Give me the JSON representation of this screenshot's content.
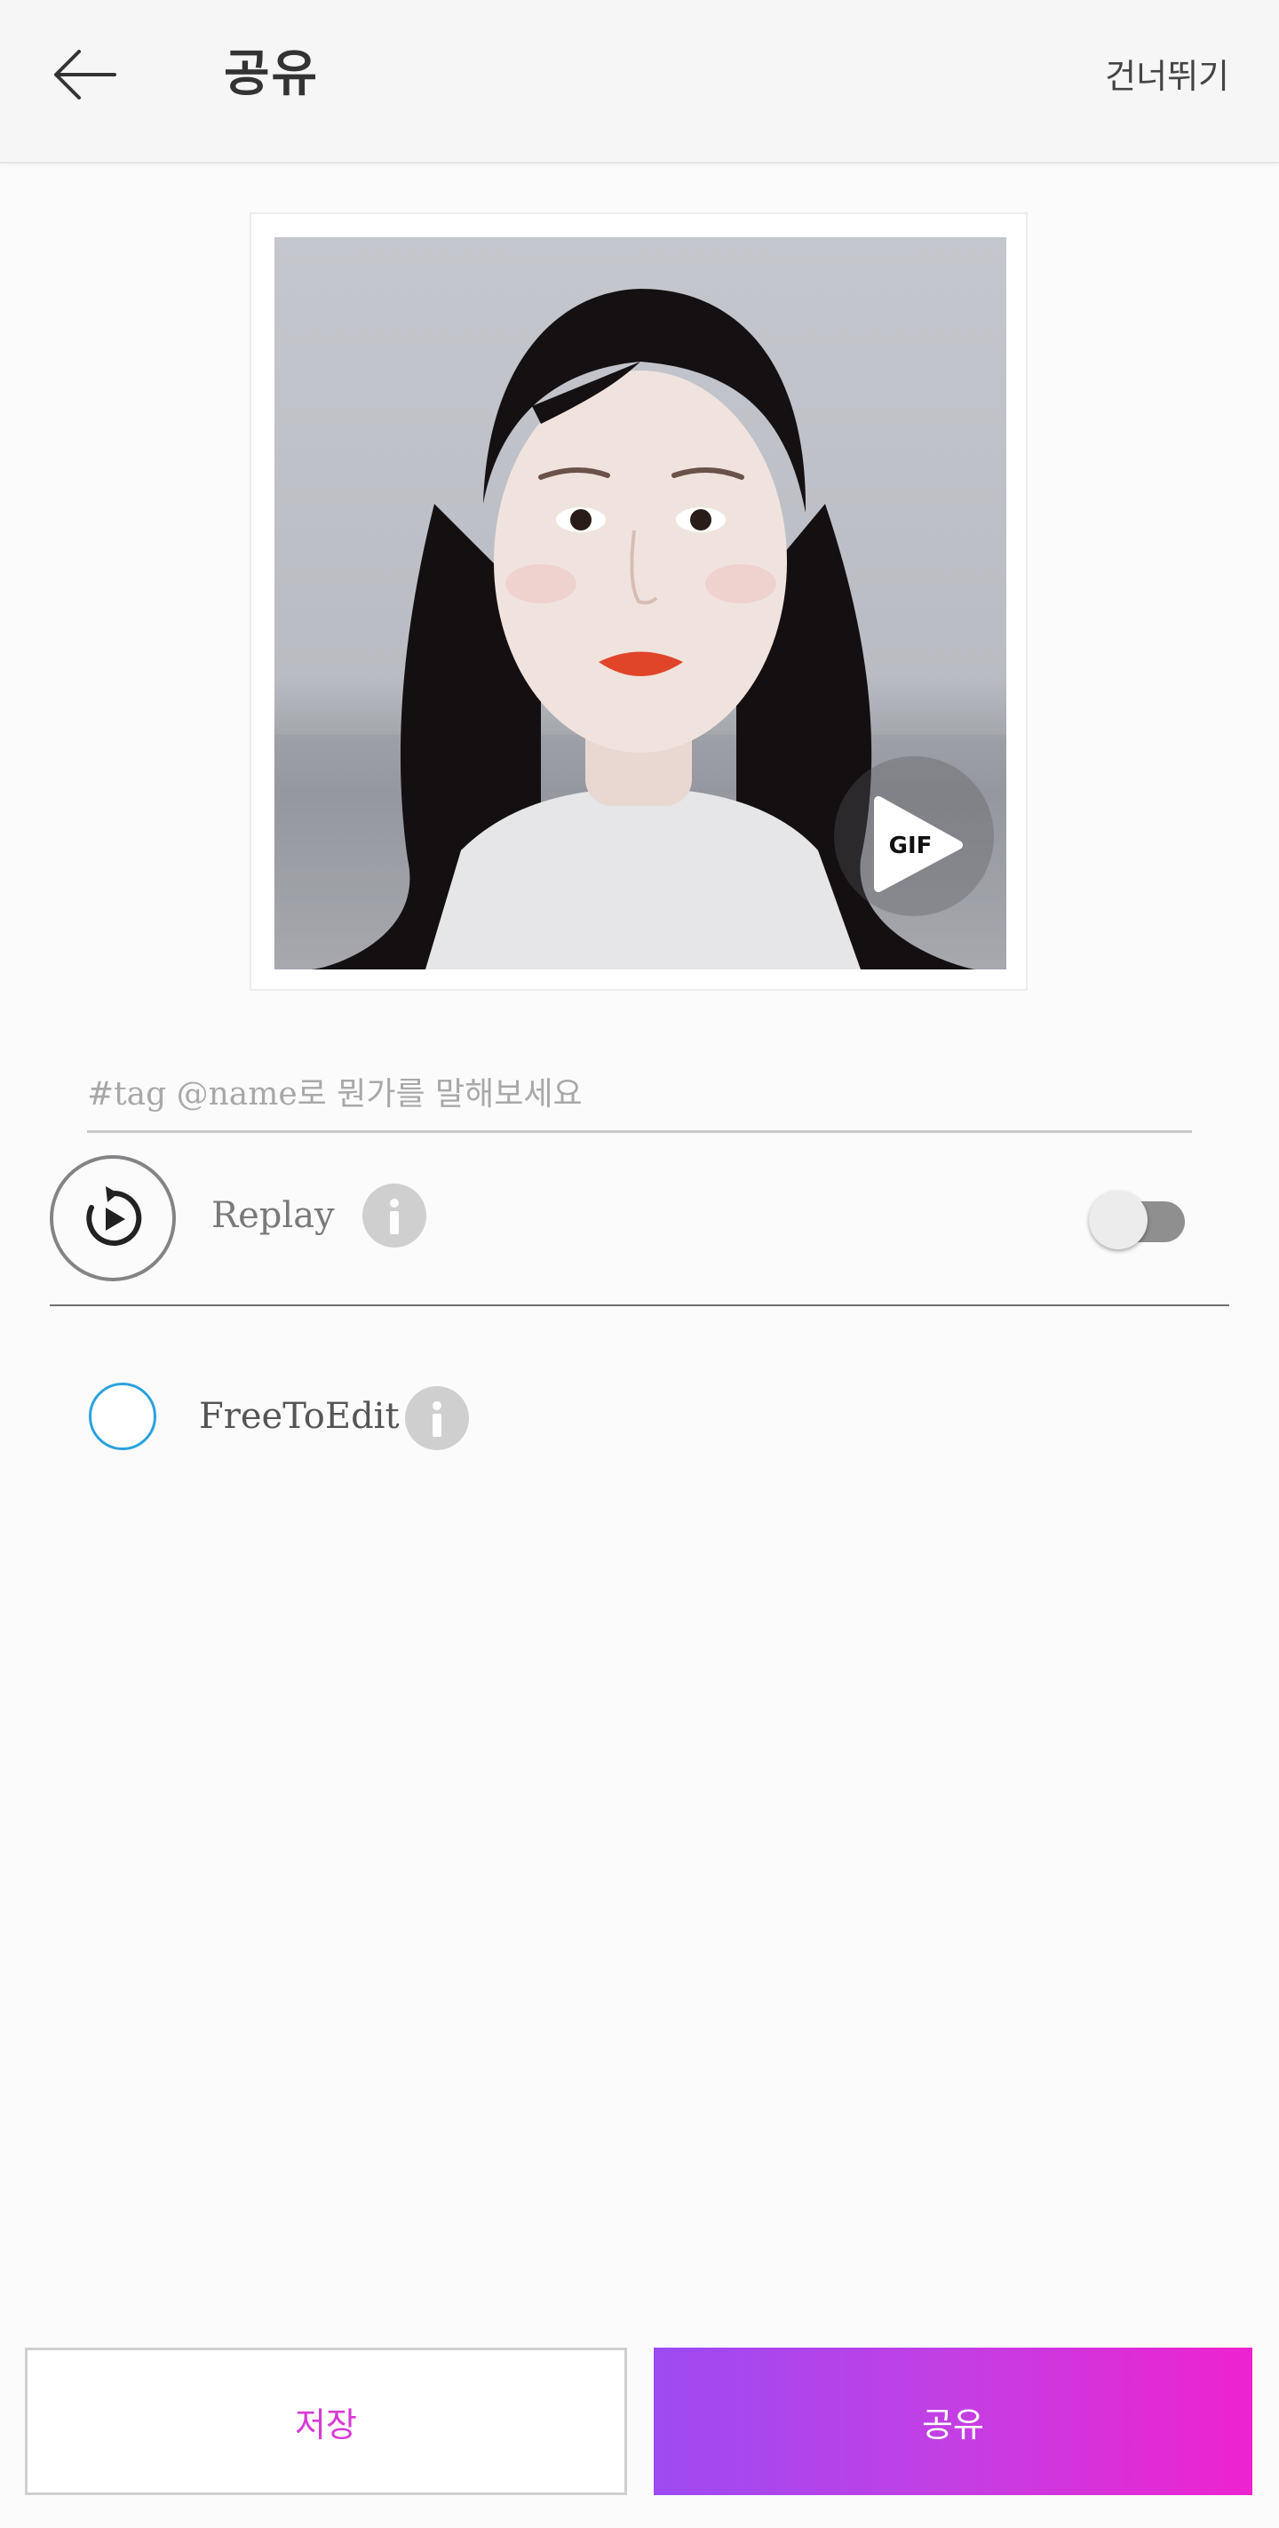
{
  "header": {
    "back_icon": "arrow-left-icon",
    "title": "공유",
    "skip_label": "건너뛰기"
  },
  "preview": {
    "badge_label": "GIF",
    "badge_icon": "play-gif-icon"
  },
  "caption": {
    "placeholder": "#tag @name로 뭔가를 말해보세요",
    "value": ""
  },
  "replay": {
    "icon": "replay-icon",
    "label": "Replay",
    "info_icon": "info-icon",
    "enabled": false
  },
  "free_to_edit": {
    "label": "FreeToEdit",
    "info_icon": "info-icon",
    "checked": false,
    "accent_color": "#2aa2de"
  },
  "actions": {
    "save_label": "저장",
    "share_label": "공유",
    "save_text_color": "#d63bd6",
    "share_gradient": [
      "#9d4bf2",
      "#ee22cf"
    ]
  }
}
